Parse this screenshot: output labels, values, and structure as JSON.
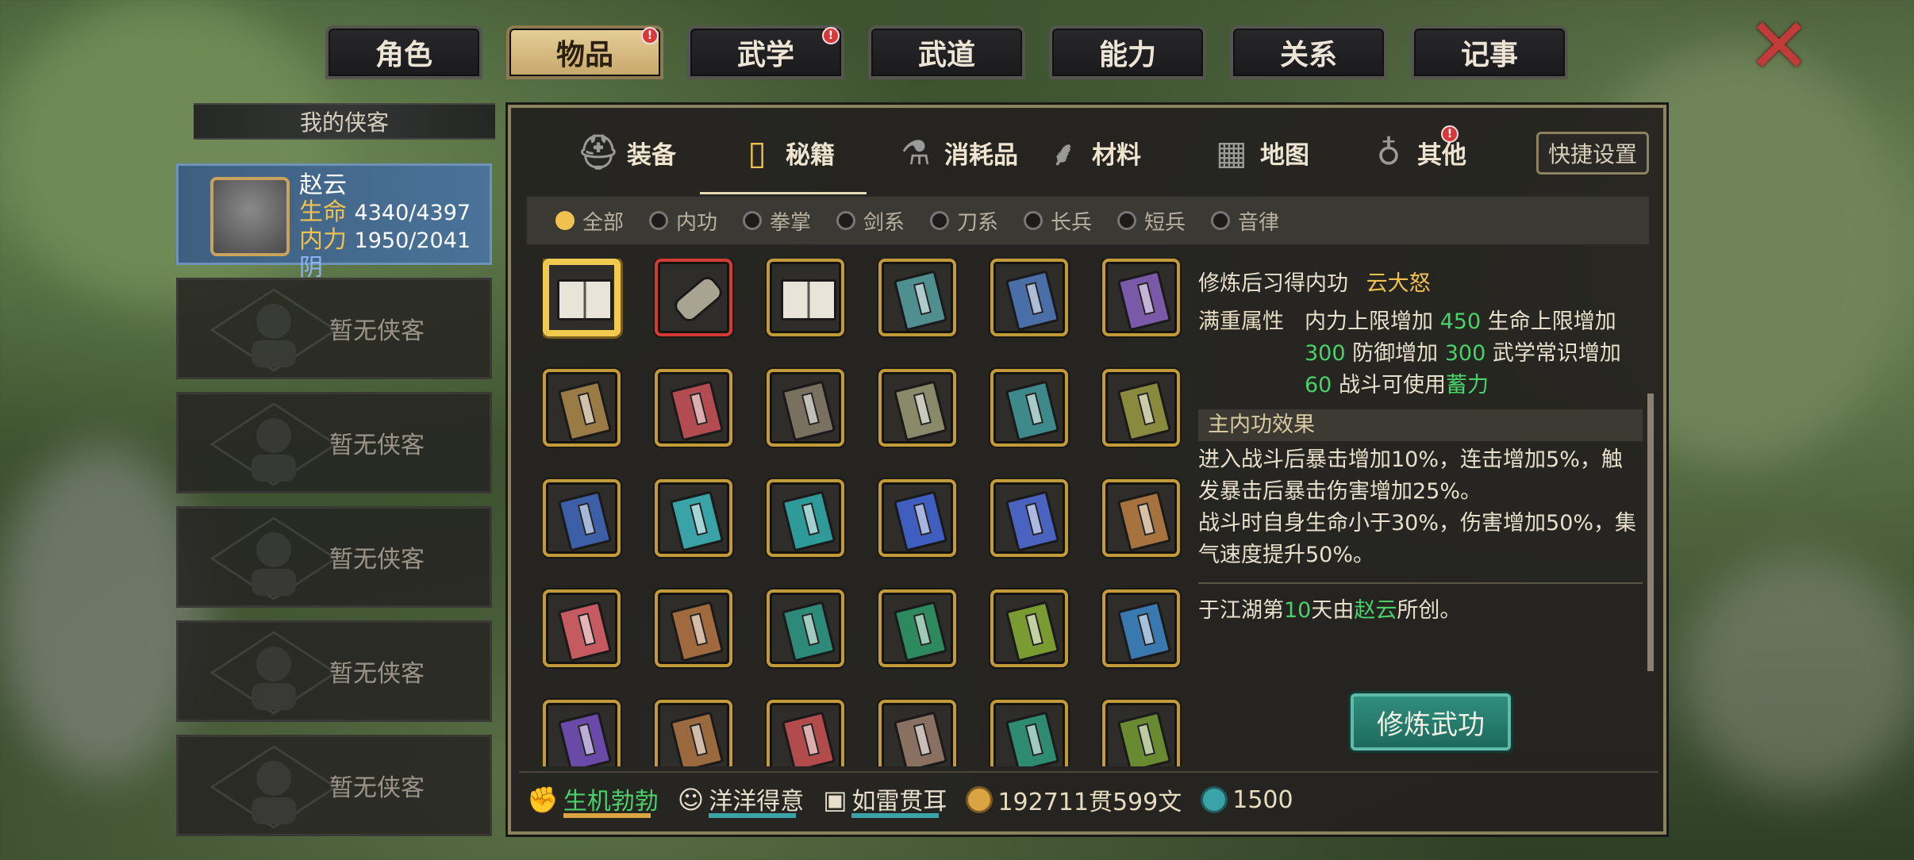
{
  "top_tabs": [
    {
      "label": "角色",
      "badge": false,
      "active": false
    },
    {
      "label": "物品",
      "badge": true,
      "active": true
    },
    {
      "label": "武学",
      "badge": true,
      "active": false
    },
    {
      "label": "武道",
      "badge": false,
      "active": false
    },
    {
      "label": "能力",
      "badge": false,
      "active": false
    },
    {
      "label": "关系",
      "badge": false,
      "active": false
    },
    {
      "label": "记事",
      "badge": false,
      "active": false
    }
  ],
  "badge_mark": "!",
  "close_icon": "✕",
  "roster": {
    "header": "我的侠客",
    "selected": {
      "name": "赵云",
      "hp_label": "生命",
      "hp": "4340/4397",
      "mp_label": "内力",
      "mp": "1950/2041",
      "affinity": "阴"
    },
    "empty_label": "暂无侠客"
  },
  "category_tabs": [
    {
      "label": "装备",
      "icon": "armor-icon"
    },
    {
      "label": "秘籍",
      "icon": "manual-icon"
    },
    {
      "label": "消耗品",
      "icon": "potion-icon"
    },
    {
      "label": "材料",
      "icon": "herb-icon"
    },
    {
      "label": "地图",
      "icon": "map-icon"
    },
    {
      "label": "其他",
      "icon": "other-icon"
    }
  ],
  "quick_settings": "快捷设置",
  "filters": [
    {
      "label": "全部",
      "on": true
    },
    {
      "label": "内功",
      "on": false
    },
    {
      "label": "拳掌",
      "on": false
    },
    {
      "label": "剑系",
      "on": false
    },
    {
      "label": "刀系",
      "on": false
    },
    {
      "label": "长兵",
      "on": false
    },
    {
      "label": "短兵",
      "on": false
    },
    {
      "label": "音律",
      "on": false
    }
  ],
  "items": [
    {
      "kind": "open",
      "color": "#e8e4d8"
    },
    {
      "kind": "scroll",
      "color": "#a9a491"
    },
    {
      "kind": "open",
      "color": "#e8e4d8"
    },
    {
      "kind": "book",
      "color": "#4f8f8f"
    },
    {
      "kind": "book",
      "color": "#4a6ea8"
    },
    {
      "kind": "book",
      "color": "#7a5aa8"
    },
    {
      "kind": "book",
      "color": "#9a7a45"
    },
    {
      "kind": "book",
      "color": "#b24c50"
    },
    {
      "kind": "book",
      "color": "#7a7060"
    },
    {
      "kind": "book",
      "color": "#8a8a6a"
    },
    {
      "kind": "book",
      "color": "#3e8a8a"
    },
    {
      "kind": "book",
      "color": "#8a8a3e"
    },
    {
      "kind": "book",
      "color": "#3d5fa8"
    },
    {
      "kind": "book",
      "color": "#3aa3a8"
    },
    {
      "kind": "book",
      "color": "#2f9a9a"
    },
    {
      "kind": "book",
      "color": "#3f5ec0"
    },
    {
      "kind": "book",
      "color": "#4a62c0"
    },
    {
      "kind": "book",
      "color": "#a6733e"
    },
    {
      "kind": "book",
      "color": "#c55a60"
    },
    {
      "kind": "book",
      "color": "#a06a3e"
    },
    {
      "kind": "book",
      "color": "#2e8a78"
    },
    {
      "kind": "book",
      "color": "#2e8a5e"
    },
    {
      "kind": "book",
      "color": "#7a9a32"
    },
    {
      "kind": "book",
      "color": "#3a78b0"
    },
    {
      "kind": "book",
      "color": "#6a4aa8"
    },
    {
      "kind": "book",
      "color": "#9a6a3e"
    },
    {
      "kind": "book",
      "color": "#b24c4c"
    },
    {
      "kind": "book",
      "color": "#8a7060"
    },
    {
      "kind": "book",
      "color": "#2e8a70"
    },
    {
      "kind": "book",
      "color": "#6a8a32"
    }
  ],
  "detail": {
    "learn_prefix": "修炼后习得内功",
    "learn_name": "云大怒",
    "full_label": "满重属性",
    "full_attr": [
      {
        "t": "内力上限增加 ",
        "c": ""
      },
      {
        "t": "450",
        "c": "g"
      },
      {
        "t": " 生命上限增加 ",
        "c": ""
      },
      {
        "t": "300",
        "c": "g"
      },
      {
        "t": " 防御增加 ",
        "c": ""
      },
      {
        "t": "300",
        "c": "g"
      },
      {
        "t": " 武学常识增加 ",
        "c": ""
      },
      {
        "t": "60",
        "c": "g"
      },
      {
        "t": " 战斗可使用",
        "c": ""
      },
      {
        "t": "蓄力",
        "c": "g"
      }
    ],
    "section": "主内功效果",
    "effect_1": "进入战斗后暴击增加10%，连击增加5%，触发暴击后暴击伤害增加25%。",
    "effect_2": "战斗时自身生命小于30%，伤害增加50%，集气速度提升50%。",
    "origin": [
      {
        "t": "于江湖第",
        "c": ""
      },
      {
        "t": "10",
        "c": "g"
      },
      {
        "t": "天由",
        "c": ""
      },
      {
        "t": "赵云",
        "c": "g"
      },
      {
        "t": "所创。",
        "c": ""
      }
    ],
    "train_button": "修炼武功"
  },
  "status": [
    {
      "icon": "strength-icon",
      "label": "生机勃勃",
      "color": "#4ad16a",
      "bar": "#d9a441"
    },
    {
      "icon": "mood-icon",
      "label": "洋洋得意",
      "color": "#e8e0cc",
      "bar": "#3aa3a8"
    },
    {
      "icon": "fame-icon",
      "label": "如雷贯耳",
      "color": "#e8e0cc",
      "bar": "#3aa3a8"
    }
  ],
  "money": "192711贯599文",
  "gems": "1500",
  "colors": {
    "gold": "#f0c14e",
    "green": "#4ad16a",
    "accent": "#c39a3a"
  }
}
